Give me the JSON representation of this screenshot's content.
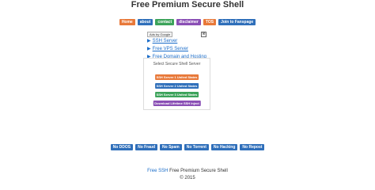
{
  "page_title": "Free Premium Secure Shell",
  "top_nav": [
    {
      "label": "Home",
      "color": "#e8793a"
    },
    {
      "label": "about",
      "color": "#2f6fba"
    },
    {
      "label": "contact",
      "color": "#3ca35a"
    },
    {
      "label": "disclaimer",
      "color": "#8a4fb5"
    },
    {
      "label": "TOS",
      "color": "#e8793a"
    },
    {
      "label": "Join to Fanspage",
      "color": "#2f6fba"
    }
  ],
  "ads": {
    "ads_by": "Ads by Google",
    "close": "⊗",
    "links": [
      "SSH Server",
      "Free VPS Server",
      "Free Domain and Hosting"
    ]
  },
  "server_panel": {
    "title": "Select Secure Shell Server",
    "buttons": [
      {
        "label": "SSH Server 1 United States",
        "color": "#e8793a"
      },
      {
        "label": "SSH Server 2 United States",
        "color": "#2f6fba"
      },
      {
        "label": "SSH Server 3 United States",
        "color": "#3ca35a"
      },
      {
        "label": "Download Lifetime SSH Inject",
        "color": "#8a4fb5"
      }
    ]
  },
  "bottom_nav": [
    "No DDOS",
    "No Fraud",
    "No Spam",
    "No Torrent",
    "No Hacking",
    "No Repost"
  ],
  "footer": {
    "link_text": "Free SSH",
    "text": " Free Premium Secure Shell",
    "copyright": "© 2015"
  }
}
